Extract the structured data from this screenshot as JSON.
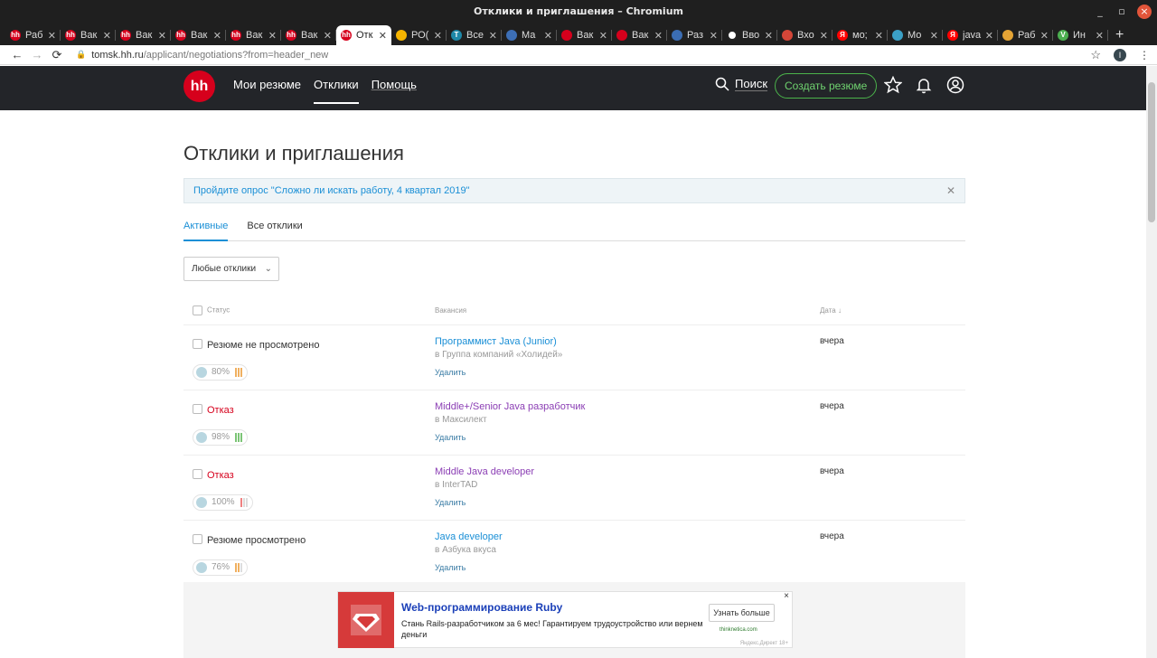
{
  "window": {
    "title": "Отклики и приглашения – Chromium",
    "controls": {
      "minimize": "_",
      "maximize": "▫",
      "close": "×"
    }
  },
  "tabs": [
    {
      "label": "Раб",
      "fav_color": "#d6001c",
      "fav_text": "hh"
    },
    {
      "label": "Вак",
      "fav_color": "#d6001c",
      "fav_text": "hh"
    },
    {
      "label": "Вак",
      "fav_color": "#d6001c",
      "fav_text": "hh"
    },
    {
      "label": "Вак",
      "fav_color": "#d6001c",
      "fav_text": "hh"
    },
    {
      "label": "Вак",
      "fav_color": "#d6001c",
      "fav_text": "hh"
    },
    {
      "label": "Вак",
      "fav_color": "#d6001c",
      "fav_text": "hh"
    },
    {
      "label": "Отк",
      "fav_color": "#d6001c",
      "fav_text": "hh",
      "active": true
    },
    {
      "label": "РО(",
      "fav_color": "#f5b400",
      "fav_text": ""
    },
    {
      "label": "Все",
      "fav_color": "#1e88a8",
      "fav_text": "T"
    },
    {
      "label": "Ма",
      "fav_color": "#3d6fb6",
      "fav_text": ""
    },
    {
      "label": "Вак",
      "fav_color": "#d6001c",
      "fav_text": ""
    },
    {
      "label": "Вак",
      "fav_color": "#d6001c",
      "fav_text": ""
    },
    {
      "label": "Раз",
      "fav_color": "#3b6db3",
      "fav_text": ""
    },
    {
      "label": "Вво",
      "fav_color": "#ffffff",
      "fav_text": ""
    },
    {
      "label": "Вхо",
      "fav_color": "#d44638",
      "fav_text": ""
    },
    {
      "label": "мо;",
      "fav_color": "#ff0000",
      "fav_text": "Я"
    },
    {
      "label": "Мо",
      "fav_color": "#3ba0c6",
      "fav_text": ""
    },
    {
      "label": "java",
      "fav_color": "#ff0000",
      "fav_text": "Я"
    },
    {
      "label": "Раб",
      "fav_color": "#e5a435",
      "fav_text": ""
    },
    {
      "label": "Ин",
      "fav_color": "#4caf50",
      "fav_text": "V"
    }
  ],
  "newtab": "+",
  "address": {
    "host": "tomsk.hh.ru",
    "path": "/applicant/negotiations?from=header_new",
    "profile_initial": "I"
  },
  "header": {
    "logo": "hh",
    "nav": [
      "Мои резюме",
      "Отклики",
      "Помощь"
    ],
    "search": "Поиск",
    "create": "Создать резюме"
  },
  "page": {
    "title": "Отклики и приглашения",
    "survey": "Пройдите опрос \"Сложно ли искать работу, 4 квартал 2019\"",
    "tabs": {
      "active": "Активные",
      "all": "Все отклики"
    },
    "filter": "Любые отклики",
    "columns": {
      "status": "Статус",
      "vacancy": "Вакансия",
      "date": "Дата"
    }
  },
  "rows": [
    {
      "status": "Резюме не просмотрено",
      "status_type": "normal",
      "percent": "80%",
      "title": "Программист Java (Junior)",
      "visited": false,
      "company": "в Группа компаний «Холидей»",
      "delete": "Удалить",
      "date": "вчера",
      "bars": [
        "#f0b060",
        "#f0b060",
        "#f0b060"
      ]
    },
    {
      "status": "Отказ",
      "status_type": "reject",
      "percent": "98%",
      "title": "Middle+/Senior Java разработчик",
      "visited": true,
      "company": "в Максилект",
      "delete": "Удалить",
      "date": "вчера",
      "bars": [
        "#7cc576",
        "#7cc576",
        "#7cc576"
      ]
    },
    {
      "status": "Отказ",
      "status_type": "reject",
      "percent": "100%",
      "title": "Middle Java developer",
      "visited": true,
      "company": "в InterTAD",
      "delete": "Удалить",
      "date": "вчера",
      "bars": [
        "#f08080",
        "#dddddd",
        "#dddddd"
      ]
    },
    {
      "status": "Резюме просмотрено",
      "status_type": "normal",
      "percent": "76%",
      "title": "Java developer",
      "visited": false,
      "company": "в Азбука вкуса",
      "delete": "Удалить",
      "date": "вчера",
      "bars": [
        "#f0b060",
        "#f0b060",
        "#dddddd"
      ]
    }
  ],
  "ad": {
    "title": "Web-программирование Ruby",
    "text": "Стань Rails-разработчиком за 6 мес! Гарантируем трудоустройство или вернем деньги",
    "button": "Узнать больше",
    "domain": "thinknetica.com",
    "close": "×",
    "footer": "Яндекс.Директ  18+"
  }
}
